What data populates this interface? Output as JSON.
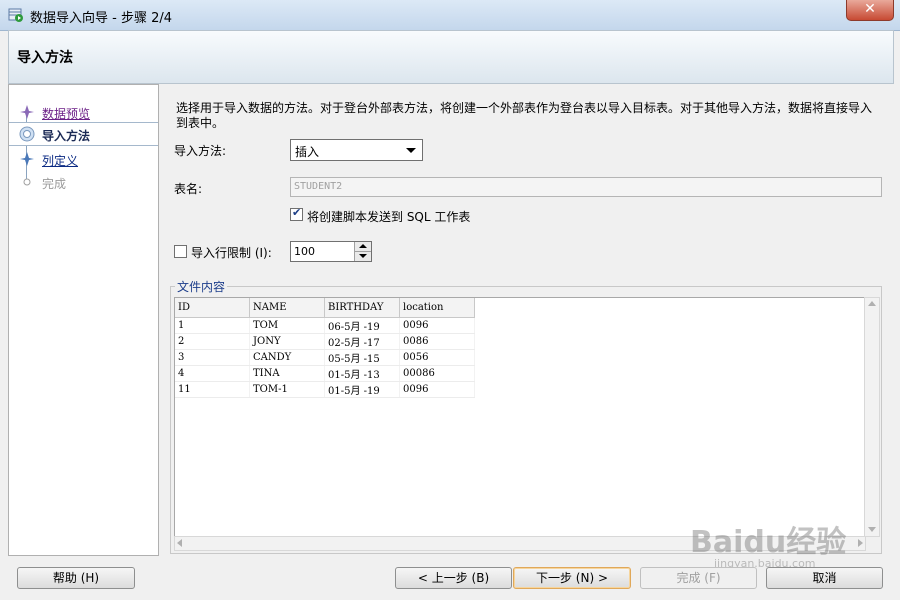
{
  "window": {
    "title": "数据导入向导 - 步骤 2/4",
    "close": "✕"
  },
  "header": {
    "title": "导入方法"
  },
  "steps": [
    {
      "label": "数据预览",
      "state": "visited"
    },
    {
      "label": "导入方法",
      "state": "current"
    },
    {
      "label": "列定义",
      "state": "link"
    },
    {
      "label": "完成",
      "state": "disabled"
    }
  ],
  "main": {
    "description": "选择用于导入数据的方法。对于登台外部表方法，将创建一个外部表作为登台表以导入目标表。对于其他导入方法，数据将直接导入到表中。",
    "import_method": {
      "label": "导入方法:",
      "value": "插入"
    },
    "table_name": {
      "label": "表名:",
      "value": "STUDENT2"
    },
    "send_script": {
      "label": "将创建脚本发送到 SQL 工作表",
      "checked": true
    },
    "row_limit": {
      "label": "导入行限制 (I):",
      "checked": false,
      "value": "100"
    },
    "file_content": {
      "legend": "文件内容",
      "columns": [
        "ID",
        "NAME",
        "BIRTHDAY",
        "location"
      ],
      "rows": [
        [
          "1",
          "TOM",
          "06-5月 -19",
          "0096"
        ],
        [
          "2",
          "JONY",
          "02-5月 -17",
          "0086"
        ],
        [
          "3",
          "CANDY",
          "05-5月 -15",
          "0056"
        ],
        [
          "4",
          "TINA",
          "01-5月 -13",
          "00086"
        ],
        [
          "11",
          "TOM-1",
          "01-5月 -19",
          "0096"
        ]
      ]
    }
  },
  "buttons": {
    "help": "帮助 (H)",
    "prev": "< 上一步 (B)",
    "next": "下一步 (N) >",
    "finish": "完成 (F)",
    "cancel": "取消"
  },
  "watermark": {
    "brand": "Baidu经验",
    "url": "jingyan.baidu.com"
  }
}
